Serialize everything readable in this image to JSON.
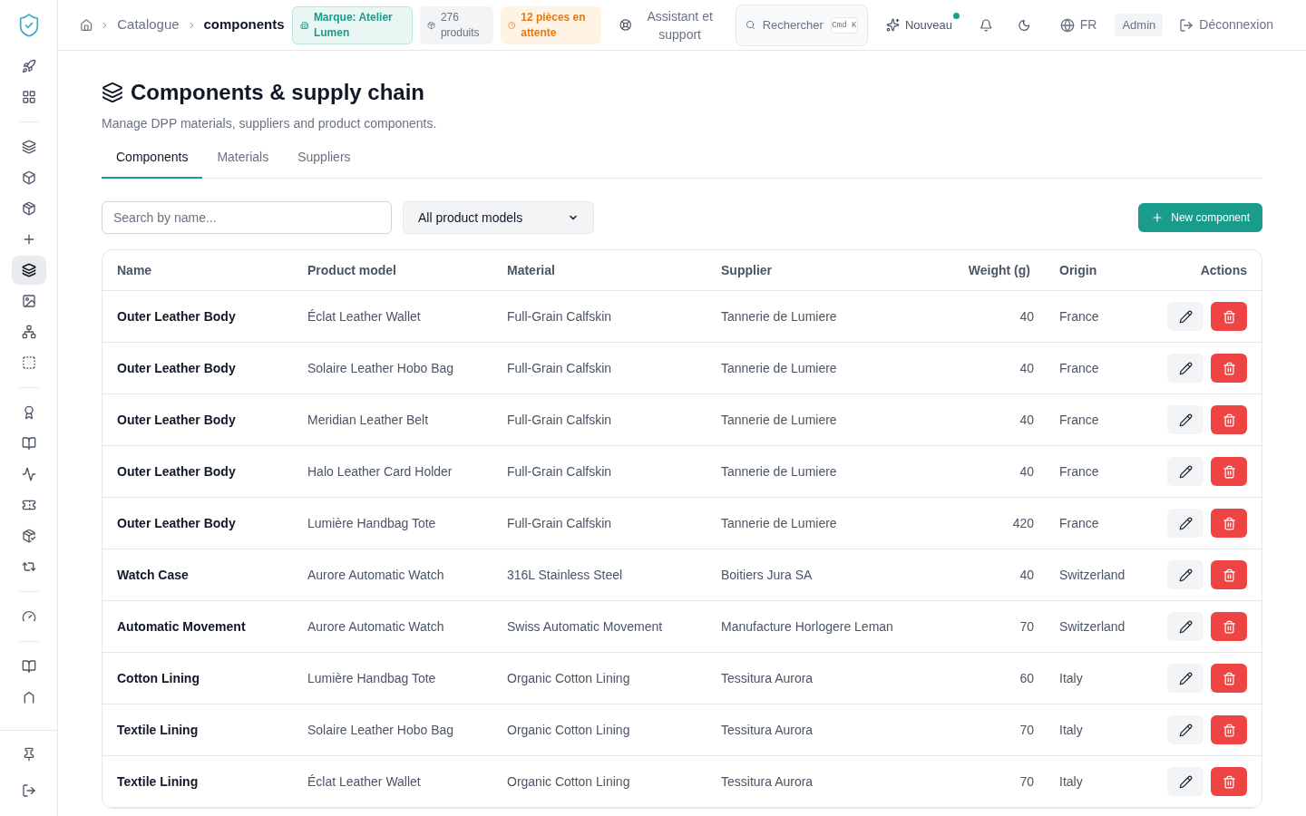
{
  "header": {
    "breadcrumbs": [
      "Catalogue",
      "components"
    ],
    "badges": [
      {
        "kind": "brand",
        "label": "Marque: Atelier Lumen"
      },
      {
        "kind": "count",
        "label": "276 produits"
      },
      {
        "kind": "pending",
        "label": "12 pièces en attente"
      }
    ],
    "support": "Assistant et support",
    "search": {
      "placeholder": "Rechercher",
      "shortcut": "Cmd K"
    },
    "new": {
      "label": "Nouveau",
      "unread": true
    },
    "language": "FR",
    "role": "Admin",
    "logout": "Déconnexion"
  },
  "sidebar": {
    "groups": [
      [
        {
          "selected": false
        },
        {
          "selected": false
        }
      ],
      [
        {
          "selected": false
        },
        {
          "selected": false
        },
        {
          "selected": false
        },
        {
          "selected": false
        },
        {
          "selected": true
        },
        {
          "selected": false
        },
        {
          "selected": false
        },
        {
          "selected": false
        }
      ],
      [
        {
          "selected": false
        },
        {
          "selected": false
        },
        {
          "selected": false
        },
        {
          "selected": false
        },
        {
          "selected": false
        },
        {
          "selected": false
        }
      ],
      [
        {
          "selected": false
        }
      ],
      [
        {
          "selected": false
        },
        {
          "selected": false
        }
      ]
    ]
  },
  "page": {
    "title": "Components & supply chain",
    "subtitle": "Manage DPP materials, suppliers and product components.",
    "tabs": [
      {
        "label": "Components",
        "selected": true
      },
      {
        "label": "Materials",
        "selected": false
      },
      {
        "label": "Suppliers",
        "selected": false
      }
    ],
    "search": {
      "placeholder": "Search by name..."
    },
    "filter": {
      "value": "All product models"
    },
    "new_button": "New component"
  },
  "table": {
    "columns": [
      "Name",
      "Product model",
      "Material",
      "Supplier",
      "Weight (g)",
      "Origin",
      "Actions"
    ],
    "rows": [
      [
        "Outer Leather Body",
        "Éclat Leather Wallet",
        "Full-Grain Calfskin",
        "Tannerie de Lumiere",
        "40",
        "France"
      ],
      [
        "Outer Leather Body",
        "Solaire Leather Hobo Bag",
        "Full-Grain Calfskin",
        "Tannerie de Lumiere",
        "40",
        "France"
      ],
      [
        "Outer Leather Body",
        "Meridian Leather Belt",
        "Full-Grain Calfskin",
        "Tannerie de Lumiere",
        "40",
        "France"
      ],
      [
        "Outer Leather Body",
        "Halo Leather Card Holder",
        "Full-Grain Calfskin",
        "Tannerie de Lumiere",
        "40",
        "France"
      ],
      [
        "Outer Leather Body",
        "Lumière Handbag Tote",
        "Full-Grain Calfskin",
        "Tannerie de Lumiere",
        "420",
        "France"
      ],
      [
        "Watch Case",
        "Aurore Automatic Watch",
        "316L Stainless Steel",
        "Boitiers Jura SA",
        "40",
        "Switzerland"
      ],
      [
        "Automatic Movement",
        "Aurore Automatic Watch",
        "Swiss Automatic Movement",
        "Manufacture Horlogere Leman",
        "70",
        "Switzerland"
      ],
      [
        "Cotton Lining",
        "Lumière Handbag Tote",
        "Organic Cotton Lining",
        "Tessitura Aurora",
        "60",
        "Italy"
      ],
      [
        "Textile Lining",
        "Solaire Leather Hobo Bag",
        "Organic Cotton Lining",
        "Tessitura Aurora",
        "70",
        "Italy"
      ],
      [
        "Textile Lining",
        "Éclat Leather Wallet",
        "Organic Cotton Lining",
        "Tessitura Aurora",
        "70",
        "Italy"
      ]
    ]
  }
}
